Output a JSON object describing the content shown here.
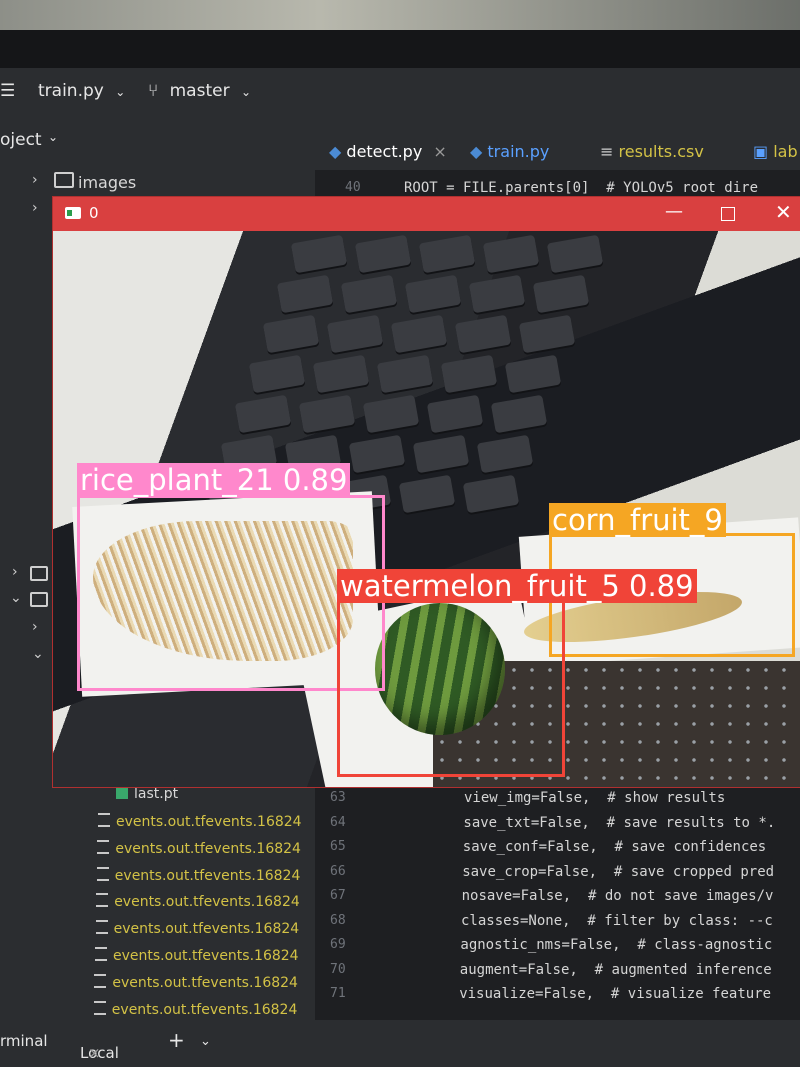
{
  "ide": {
    "toolbar": {
      "file": "train.py",
      "branch": "master"
    },
    "project_label": "oject",
    "tree": {
      "images_folder": "images",
      "last_weight": "last.pt"
    },
    "event_files": [
      "events.out.tfevents.16824",
      "events.out.tfevents.16824",
      "events.out.tfevents.16824",
      "events.out.tfevents.16824",
      "events.out.tfevents.16824",
      "events.out.tfevents.16824",
      "events.out.tfevents.16824",
      "events.out.tfevents.16824"
    ],
    "tabs": [
      "detect.py",
      "train.py",
      "results.csv",
      "lab"
    ],
    "code_top": {
      "line_no": "40",
      "text": "ROOT = FILE.parents[0]  # YOLOv5 root dire"
    },
    "code_lines": [
      {
        "no": "63",
        "text": "view_img=False,  # show results"
      },
      {
        "no": "64",
        "text": "save_txt=False,  # save results to *."
      },
      {
        "no": "65",
        "text": "save_conf=False,  # save confidences"
      },
      {
        "no": "66",
        "text": "save_crop=False,  # save cropped pred"
      },
      {
        "no": "67",
        "text": "nosave=False,  # do not save images/v"
      },
      {
        "no": "68",
        "text": "classes=None,  # filter by class: --c"
      },
      {
        "no": "69",
        "text": "agnostic_nms=False,  # class-agnostic"
      },
      {
        "no": "70",
        "text": "augment=False,  # augmented inference"
      },
      {
        "no": "71",
        "text": "visualize=False,  # visualize feature"
      }
    ],
    "bottom": {
      "terminal": "rminal",
      "local_tab": "Local"
    }
  },
  "window": {
    "title": "0",
    "detections": [
      {
        "label": "rice_plant_21  0.89",
        "color": "#ff88cc"
      },
      {
        "label": "corn_fruit_9",
        "color": "#f5a623"
      },
      {
        "label": "watermelon_fruit_5  0.89",
        "color": "#f04438"
      }
    ]
  }
}
